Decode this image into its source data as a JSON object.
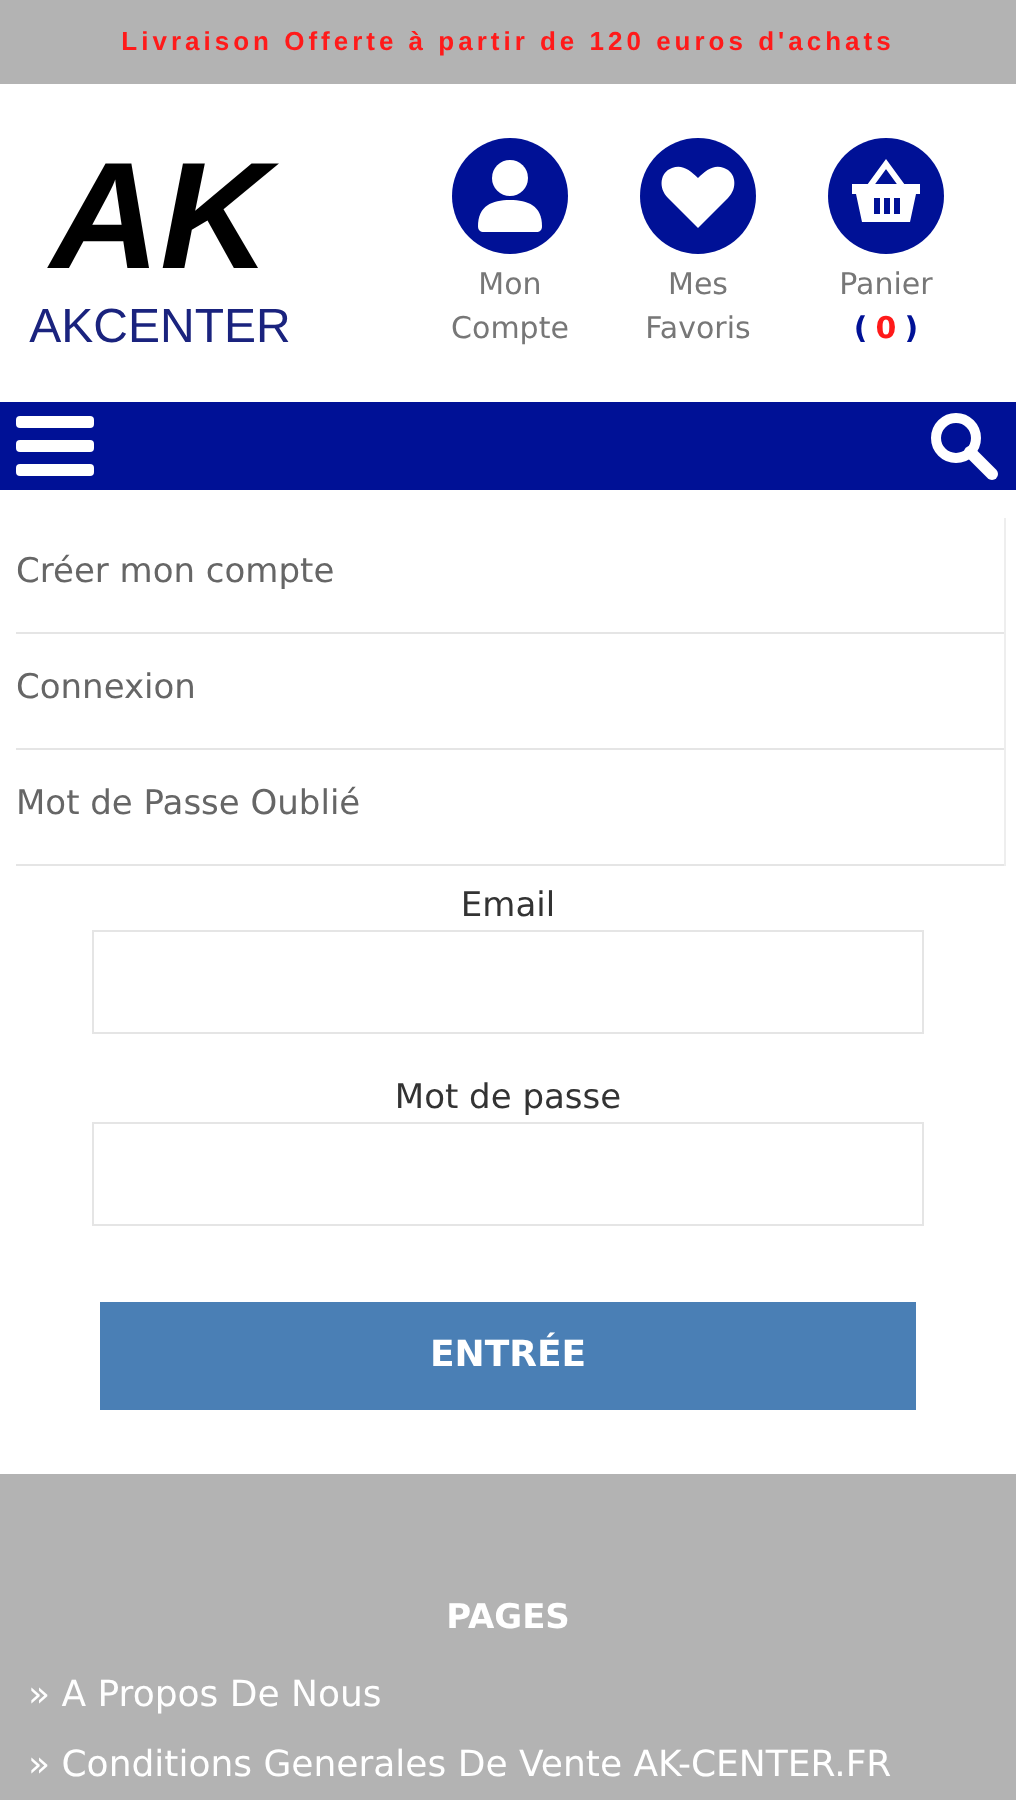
{
  "promo_banner": "Livraison Offerte à partir de 120 euros d'achats",
  "logo": {
    "mark": "AK",
    "name": "AKCENTER"
  },
  "header_links": [
    {
      "kind": "account",
      "lines": [
        "Mon",
        "Compte"
      ]
    },
    {
      "kind": "favorites",
      "lines": [
        "Mes",
        "Favoris"
      ]
    },
    {
      "kind": "cart",
      "lines": [
        "Panier"
      ],
      "count_open": "(",
      "count": "0",
      "count_close": ")"
    }
  ],
  "account_menu": [
    "Créer mon compte",
    "Connexion",
    "Mot de Passe Oublié"
  ],
  "login_form": {
    "fields": [
      {
        "label": "Email"
      },
      {
        "label": "Mot de passe"
      }
    ],
    "submit": "ENTRÉE"
  },
  "footer": {
    "heading": "PAGES",
    "links": [
      "» A Propos De Nous",
      "» Conditions Generales De Vente AK-CENTER.FR"
    ]
  }
}
